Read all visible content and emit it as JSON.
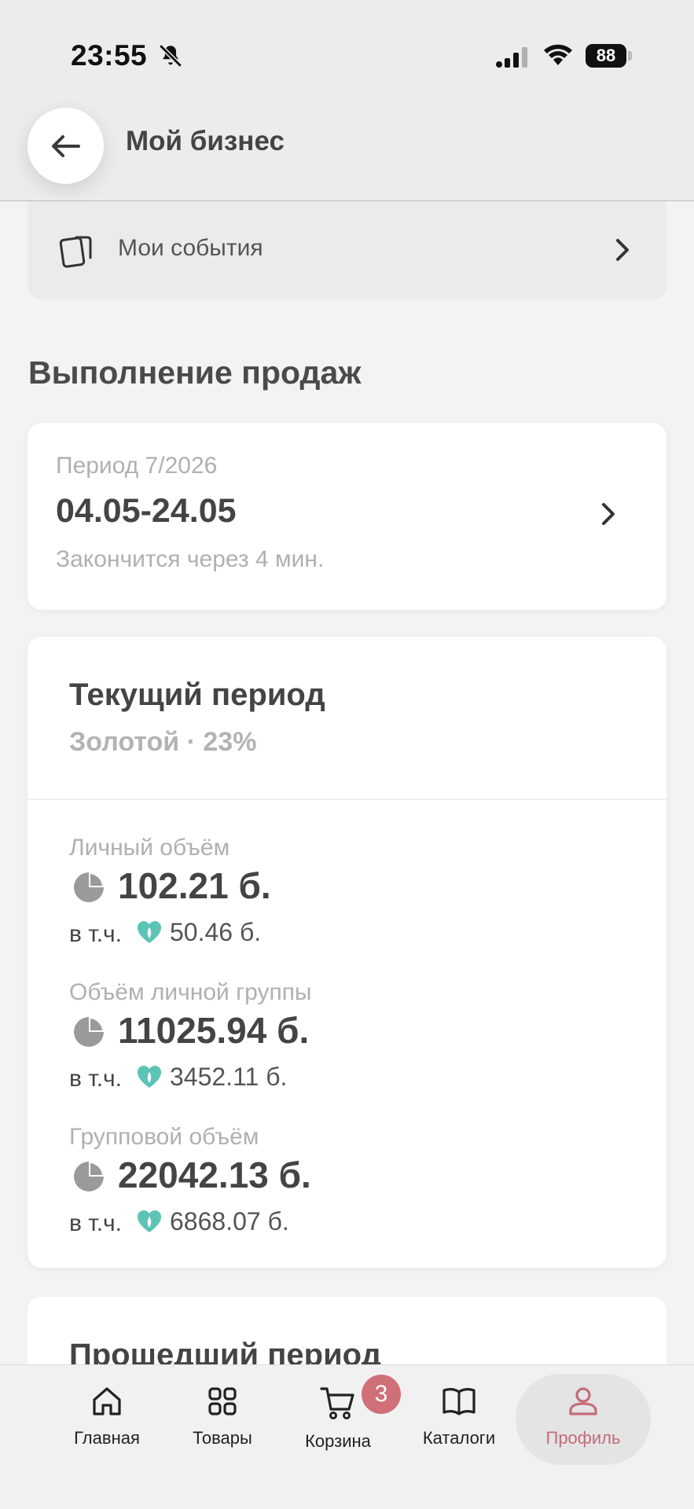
{
  "status_bar": {
    "time": "23:55",
    "battery": "88",
    "icons": [
      "bell-slash-icon",
      "signal-icon",
      "wifi-icon",
      "battery-icon"
    ]
  },
  "header": {
    "title": "Мой бизнес",
    "back_icon": "arrow-left-icon"
  },
  "events_row": {
    "label": "Мои события",
    "icon": "cards-icon"
  },
  "sales": {
    "section_title": "Выполнение продаж",
    "period": {
      "label": "Период 7/2026",
      "dates": "04.05-24.05",
      "remaining": "Закончится через 4 мин."
    },
    "current": {
      "title": "Текущий период",
      "subtitle": "Золотой · 23%",
      "metrics": [
        {
          "label": "Личный объём",
          "value": "102.21 б.",
          "incl_prefix": "в т.ч.",
          "incl_value": "50.46 б."
        },
        {
          "label": "Объём личной группы",
          "value": "11025.94 б.",
          "incl_prefix": "в т.ч.",
          "incl_value": "3452.11 б."
        },
        {
          "label": "Групповой объём",
          "value": "22042.13 б.",
          "incl_prefix": "в т.ч.",
          "incl_value": "6868.07 б."
        }
      ]
    },
    "past_title": "Прошедший период"
  },
  "bottom_nav": {
    "items": [
      {
        "label": "Главная",
        "icon": "home-icon"
      },
      {
        "label": "Товары",
        "icon": "grid-icon"
      },
      {
        "label": "Корзина",
        "icon": "cart-icon"
      },
      {
        "label": "Каталоги",
        "icon": "book-icon"
      },
      {
        "label": "Профиль",
        "icon": "profile-icon"
      }
    ],
    "active": "Профиль",
    "cart_badge": "3"
  },
  "colors": {
    "accent": "#c46c78",
    "badge": "#cf6f77",
    "leaf": "#5cc4b5",
    "pie": "#9a9a9a"
  }
}
